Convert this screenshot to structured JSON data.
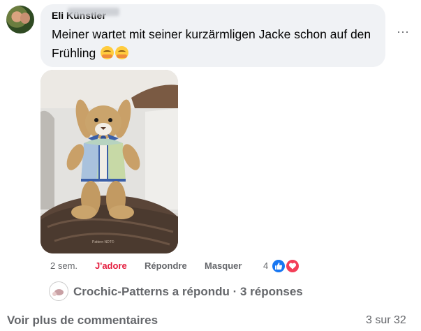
{
  "comment": {
    "author": "Eli       Künstler",
    "text": "Meiner wartet mit seiner kurzärmligen Jacke schon auf den Frühling",
    "emojis": [
      "smiling-face-with-hearts-icon",
      "smiling-face-with-hearts-icon"
    ],
    "photo_watermark": "Pattern NDT©"
  },
  "actions": {
    "time": "2 sem.",
    "like": "J'adore",
    "reply": "Répondre",
    "hide": "Masquer"
  },
  "reactions": {
    "count": "4",
    "types": [
      "like-icon",
      "love-icon"
    ],
    "colors": {
      "like": "#1877f2",
      "love": "#f33e58"
    }
  },
  "replies": {
    "summary": "Crochic-Patterns a répondu · 3 réponses"
  },
  "footer": {
    "see_more": "Voir plus de commentaires",
    "pager": "3 sur 32"
  },
  "colors": {
    "bubble": "#f0f2f5",
    "secondary_text": "#65676b",
    "love_accent": "#e41e3f"
  }
}
